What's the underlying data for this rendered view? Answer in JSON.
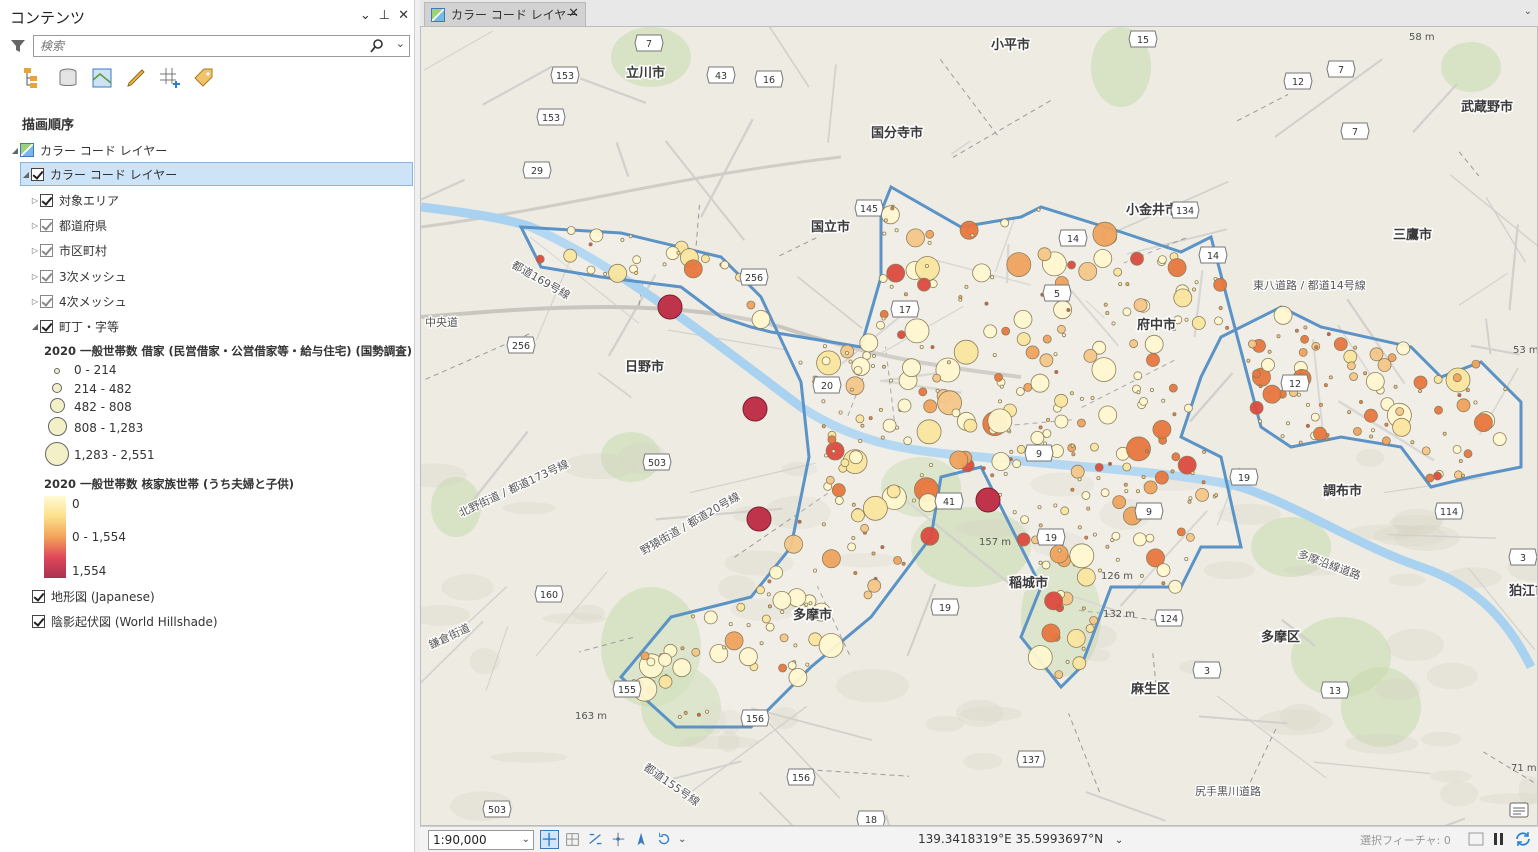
{
  "contents_pane": {
    "title": "コンテンツ",
    "search": {
      "placeholder": "検索"
    },
    "section_title": "描画順序",
    "map_node": {
      "label": "カラー コード レイヤー"
    },
    "group_layer": {
      "label": "カラー コード レイヤー",
      "checked": true
    },
    "layers": [
      {
        "label": "対象エリア",
        "checked": true,
        "enabled": true
      },
      {
        "label": "都道府県",
        "checked": true,
        "enabled": false
      },
      {
        "label": "市区町村",
        "checked": true,
        "enabled": false
      },
      {
        "label": "3次メッシュ",
        "checked": true,
        "enabled": false
      },
      {
        "label": "4次メッシュ",
        "checked": true,
        "enabled": false
      },
      {
        "label": "町丁・字等",
        "checked": true,
        "enabled": true,
        "expanded": true
      }
    ],
    "legend_size": {
      "title": "2020 一般世帯数 借家 (民営借家・公営借家等・給与住宅) (国勢調査)",
      "classes": [
        "0 - 214",
        "214 - 482",
        "482 - 808",
        "808 - 1,283",
        "1,283 - 2,551"
      ]
    },
    "legend_color": {
      "title": "2020 一般世帯数 核家族世帯 (うち夫婦と子供)",
      "labels": [
        "0",
        "0 - 1,554",
        "1,554"
      ]
    },
    "basemaps": [
      {
        "label": "地形図 (Japanese)",
        "checked": true
      },
      {
        "label": "陰影起伏図 (World Hillshade)",
        "checked": true
      }
    ]
  },
  "map_tab": {
    "label": "カラー コード レイヤー"
  },
  "map": {
    "place_labels": [
      "小平市",
      "立川市",
      "国分寺市",
      "武蔵野市",
      "小金井市",
      "国立市",
      "三鷹市",
      "府中市",
      "日野市",
      "調布市",
      "稲城市",
      "多摩市",
      "多摩区",
      "狛江市",
      "麻生区"
    ],
    "road_labels": [
      "中央道",
      "都道169号線",
      "東八道路 / 都道14号線",
      "北野街道 / 都道173号線",
      "野猿街道 / 都道20号線",
      "多摩沿線道路",
      "都道155号線",
      "鎌倉街道",
      "尻手黒川道路"
    ],
    "route_shields": [
      "7",
      "15",
      "153",
      "43",
      "16",
      "12",
      "7",
      "153",
      "7",
      "29",
      "145",
      "134",
      "14",
      "256",
      "14",
      "5",
      "17",
      "20",
      "9",
      "9",
      "256",
      "503",
      "41",
      "19",
      "19",
      "12",
      "19",
      "114",
      "3",
      "160",
      "124",
      "3",
      "155",
      "13",
      "156",
      "137",
      "156",
      "503",
      "18"
    ],
    "elevations": [
      "58 m",
      "53 m",
      "157 m",
      "126 m",
      "132 m",
      "163 m",
      "71 m"
    ]
  },
  "status_bar": {
    "scale": "1:90,000",
    "coordinates": "139.3418319°E 35.5993697°N",
    "selected_features": "選択フィーチャ: 0"
  }
}
